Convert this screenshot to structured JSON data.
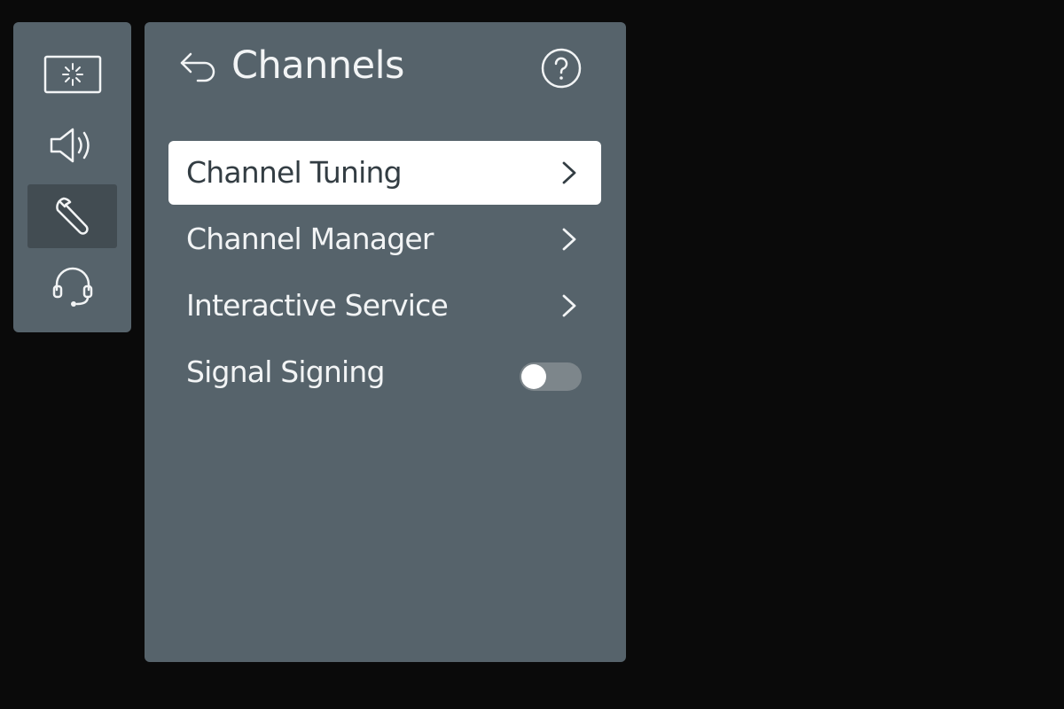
{
  "rail": {
    "items": [
      {
        "icon": "picture-icon",
        "active": false
      },
      {
        "icon": "speaker-icon",
        "active": false
      },
      {
        "icon": "wrench-icon",
        "active": true
      },
      {
        "icon": "headset-icon",
        "active": false
      }
    ]
  },
  "panel": {
    "title": "Channels",
    "back_icon": "back-arrow-icon",
    "help_icon": "help-icon",
    "items": [
      {
        "label": "Channel Tuning",
        "type": "submenu",
        "selected": true
      },
      {
        "label": "Channel Manager",
        "type": "submenu",
        "selected": false
      },
      {
        "label": "Interactive Service",
        "type": "submenu",
        "selected": false
      },
      {
        "label": "Signal Signing",
        "type": "toggle",
        "selected": false,
        "value": false
      }
    ]
  },
  "colors": {
    "background": "#0a0a0a",
    "panel": "#56636b",
    "rail_active": "#424c52",
    "selected_item": "#ffffff",
    "text": "#f2f4f5"
  }
}
